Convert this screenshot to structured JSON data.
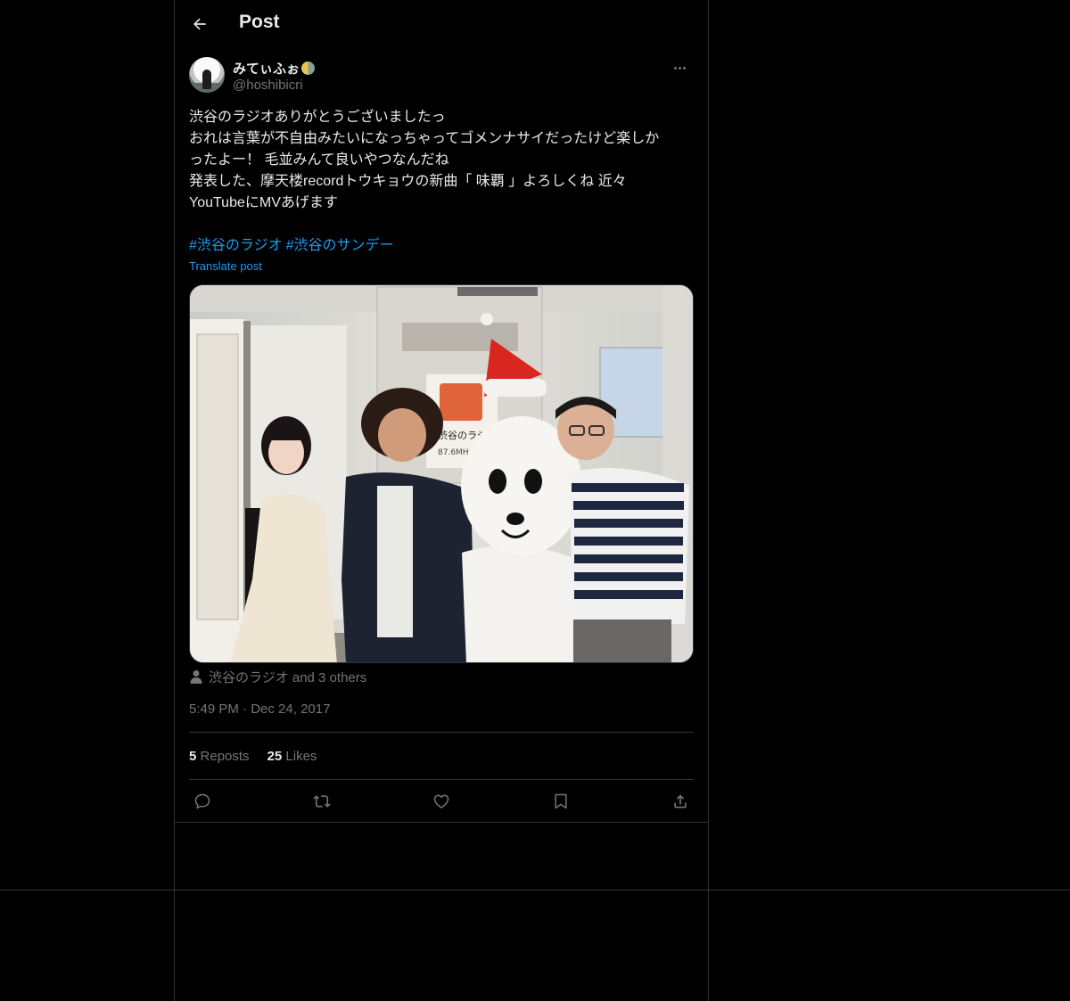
{
  "header": {
    "title": "Post",
    "back_icon": "arrow-left-icon"
  },
  "author": {
    "display_name": "みてぃふぉ",
    "handle": "@hoshibicri"
  },
  "post": {
    "lines": [
      "渋谷のラジオありがとうございましたっ",
      "おれは言葉が不自由みたいになっちゃってゴメンナサイだったけど楽しか",
      "ったよー！ 毛並みんて良いやつなんだね",
      "発表した、摩天楼recordトウキョウの新曲「 味覇 」よろしくね 近々",
      "YouTubeにMVあげます"
    ],
    "hashtags": [
      "#渋谷のラジオ",
      "#渋谷のサンデー"
    ],
    "translate_label": "Translate post"
  },
  "media": {
    "poster_brand": "渋谷のラジオ",
    "poster_freq": "87.6MHz FM"
  },
  "tagged": {
    "text": "渋谷のラジオ and 3 others",
    "icon": "person-icon"
  },
  "timestamp": {
    "time": "5:49 PM",
    "separator": "·",
    "date": "Dec 24, 2017"
  },
  "stats": {
    "reposts_count": "5",
    "reposts_label": "Reposts",
    "likes_count": "25",
    "likes_label": "Likes"
  },
  "actions": [
    "reply-icon",
    "repost-icon",
    "like-icon",
    "bookmark-icon",
    "share-icon"
  ],
  "colors": {
    "accent": "#1d9bf0",
    "muted": "#71767b",
    "text": "#e7e9ea",
    "border": "#2f3336",
    "background": "#000000"
  }
}
